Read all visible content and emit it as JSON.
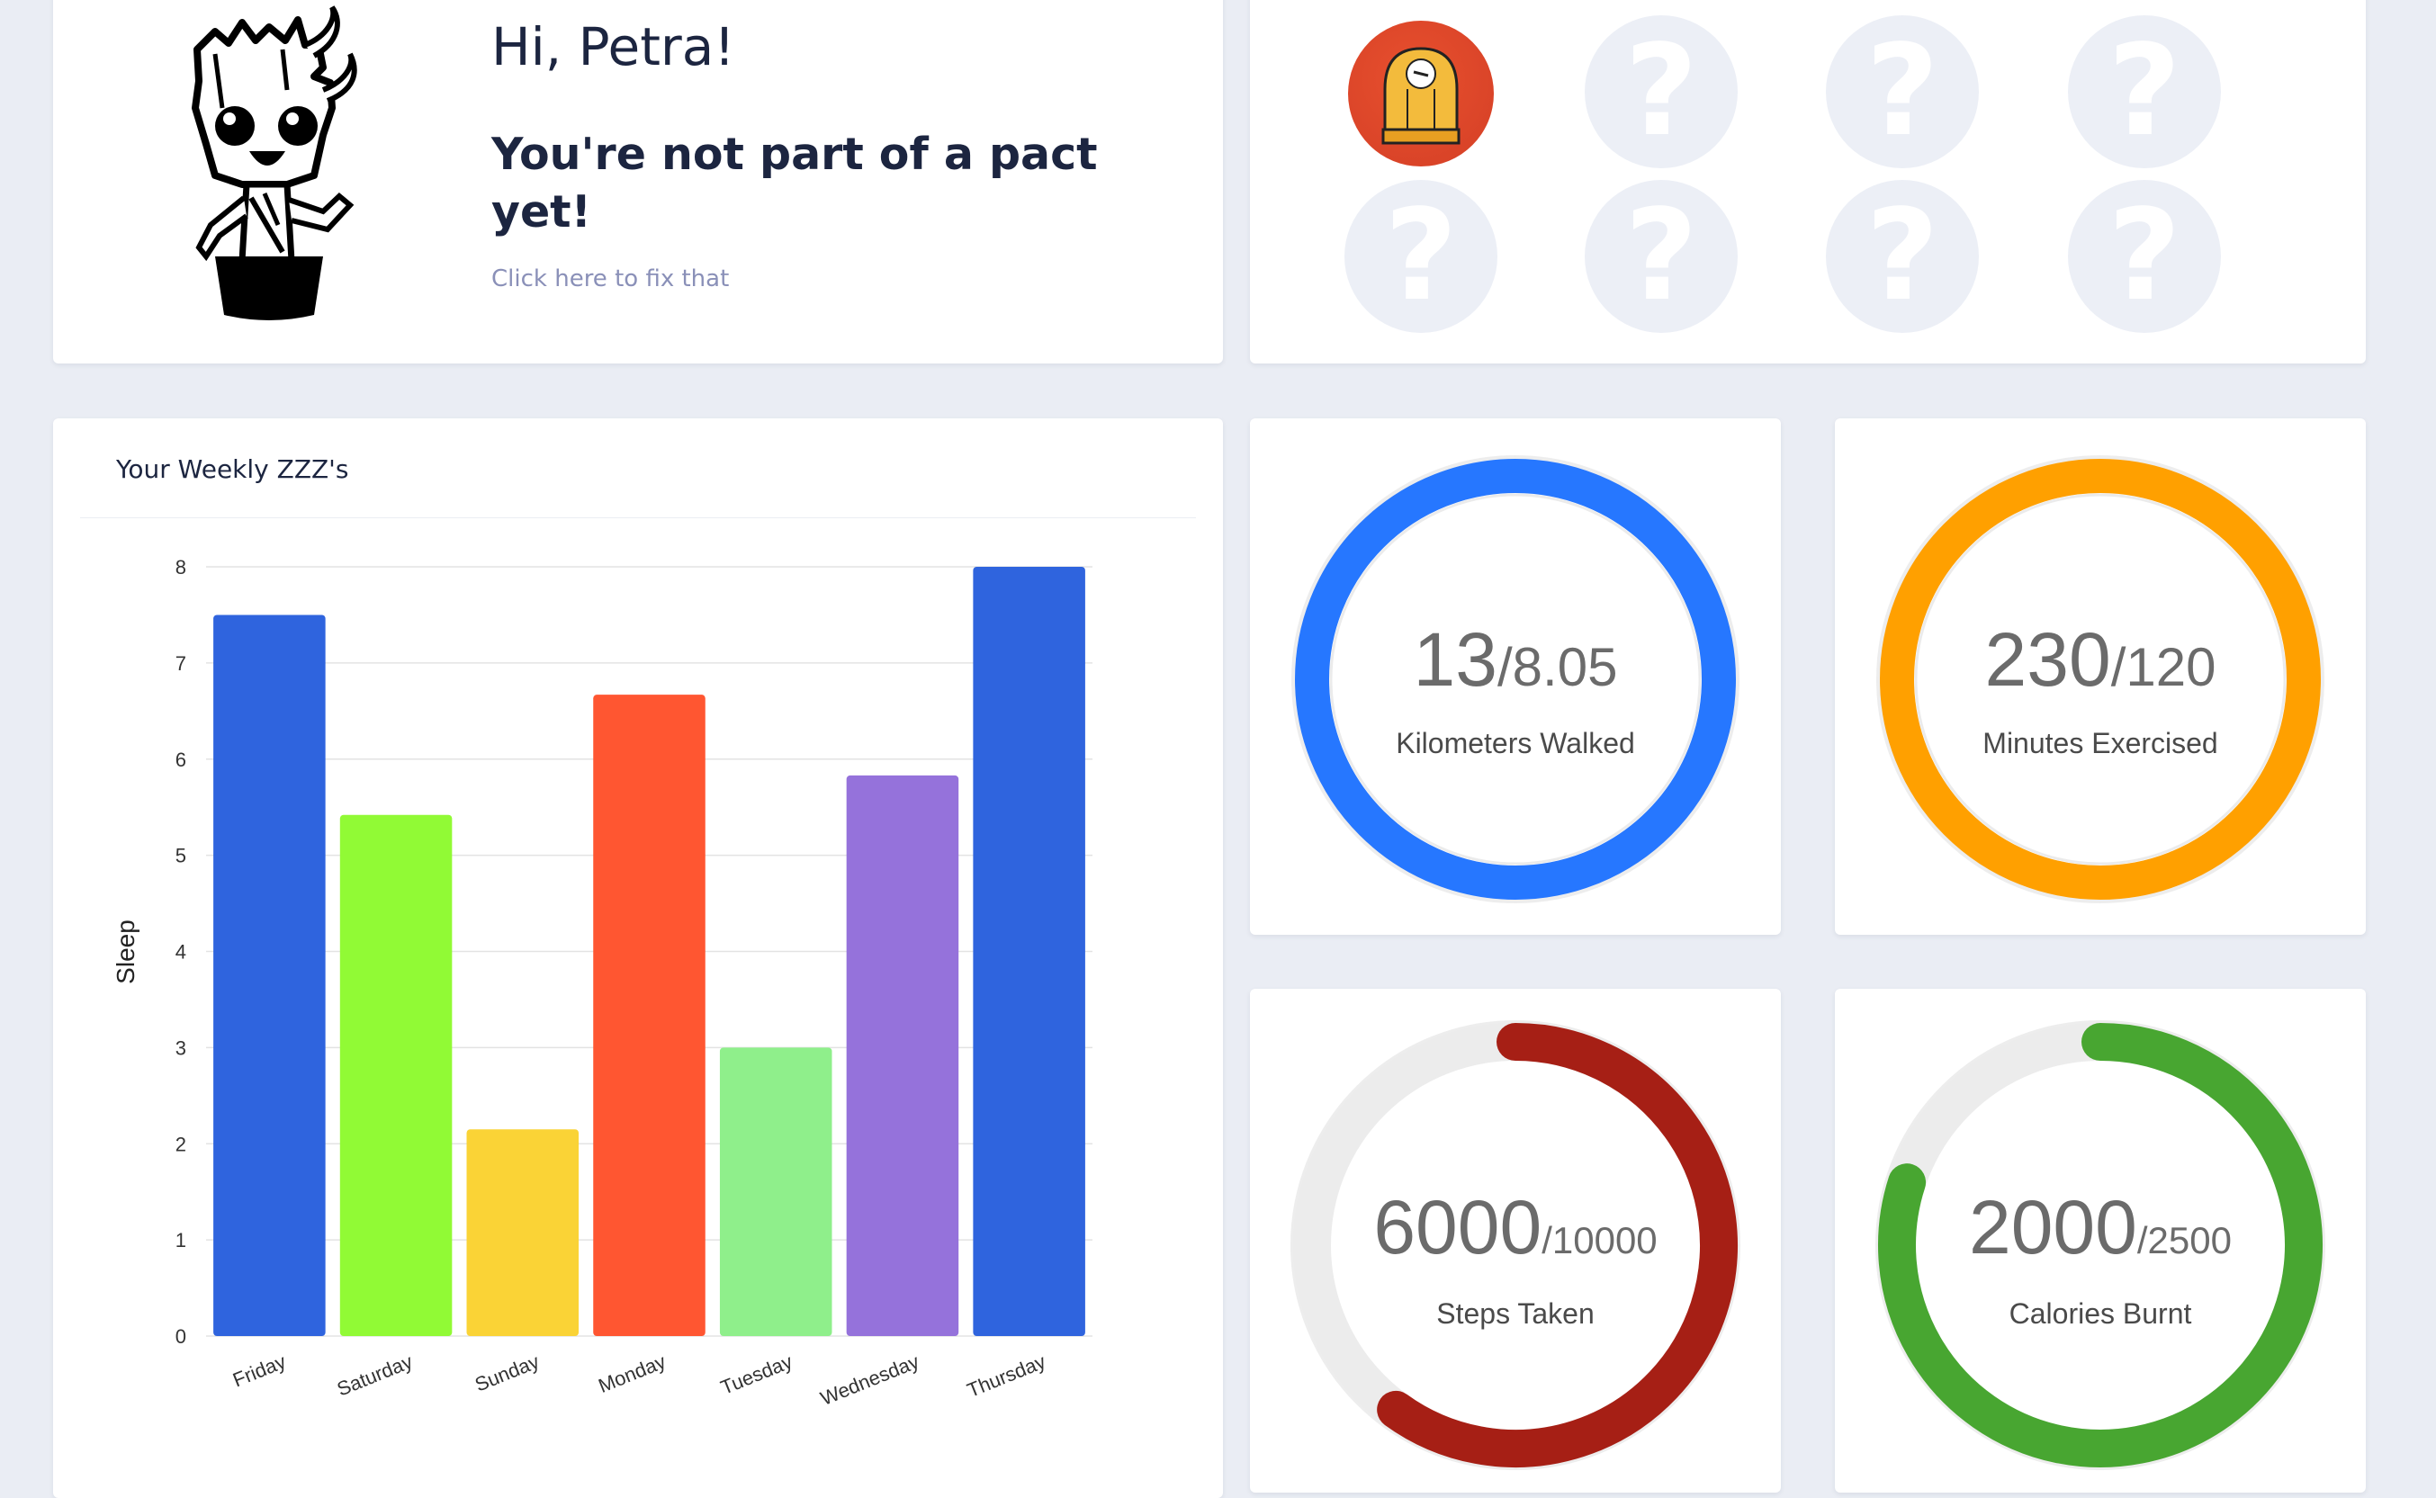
{
  "welcome": {
    "greeting": "Hi, Petra!",
    "pact_title": "You're not part of a pact yet!",
    "pact_link": "Click here to fix that",
    "mascot_icon": "groot-mascot-icon"
  },
  "badges": {
    "earned": [
      {
        "icon": "beanie-badge-icon",
        "color": "#d8442a"
      }
    ],
    "locked_count": 7,
    "locked_symbol": "?"
  },
  "chart": {
    "title": "Your Weekly ZZZ's",
    "chart_data": {
      "type": "bar",
      "title": "Your Weekly ZZZ's",
      "xlabel": "",
      "ylabel": "Sleep",
      "ylim": [
        0,
        8
      ],
      "yticks": [
        "0",
        "1",
        "2",
        "3",
        "4",
        "5",
        "6",
        "7",
        "8"
      ],
      "categories": [
        "Friday",
        "Saturday",
        "Sunday",
        "Monday",
        "Tuesday",
        "Wednesday",
        "Thursday"
      ],
      "values": [
        7.5,
        5.42,
        2.15,
        6.67,
        3.0,
        5.83,
        8.0
      ],
      "colors": [
        "#2f64de",
        "#91fa35",
        "#fad336",
        "#ff5631",
        "#8fef8b",
        "#9572db",
        "#2f64de"
      ],
      "grid": true
    }
  },
  "stats": [
    {
      "id": "km",
      "value": "13",
      "target": "/8.05",
      "label": "Kilometers Walked",
      "progress": 1.0,
      "color": "#2677ff"
    },
    {
      "id": "min",
      "value": "230",
      "target": "/120",
      "label": "Minutes Exercised",
      "progress": 1.0,
      "color": "#ffa000"
    },
    {
      "id": "steps",
      "value": "6000",
      "target": "/10000",
      "label": "Steps Taken",
      "progress": 0.6,
      "color": "#a61f15"
    },
    {
      "id": "cal",
      "value": "2000",
      "target": "/2500",
      "label": "Calories Burnt",
      "progress": 0.8,
      "color": "#48a631"
    }
  ]
}
